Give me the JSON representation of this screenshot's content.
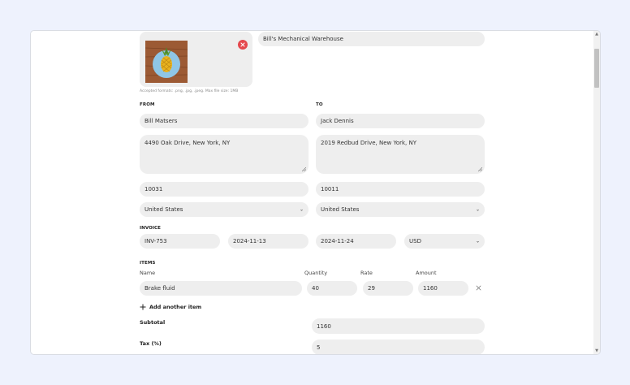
{
  "logo": {
    "accepted_formats": "Accepted formats: .png, .jpg, .jpeg. Max file size: 1MB",
    "image_alt": "pineapple-logo"
  },
  "company_name": "Bill's Mechanical Warehouse",
  "from": {
    "heading": "FROM",
    "name": "Bill Matsers",
    "address": "4490 Oak Drive, New York, NY",
    "zip": "10031",
    "country": "United States"
  },
  "to": {
    "heading": "TO",
    "name": "Jack Dennis",
    "address": "2019 Redbud Drive, New York, NY",
    "zip": "10011",
    "country": "United States"
  },
  "invoice": {
    "heading": "INVOICE",
    "number": "INV-753",
    "issue_date": "2024-11-13",
    "due_date": "2024-11-24",
    "currency": "USD"
  },
  "items": {
    "heading": "ITEMS",
    "col_name": "Name",
    "col_quantity": "Quantity",
    "col_rate": "Rate",
    "col_amount": "Amount",
    "rows": [
      {
        "name": "Brake fluid",
        "quantity": "40",
        "rate": "29",
        "amount": "1160"
      }
    ],
    "add_label": "Add another item"
  },
  "totals": {
    "subtotal_label": "Subtotal",
    "subtotal_value": "1160",
    "tax_label": "Tax (%)",
    "tax_value": "5"
  },
  "colors": {
    "page_bg": "#eef2fd",
    "field_bg": "#eeeeee",
    "remove_red": "#e5484d"
  }
}
